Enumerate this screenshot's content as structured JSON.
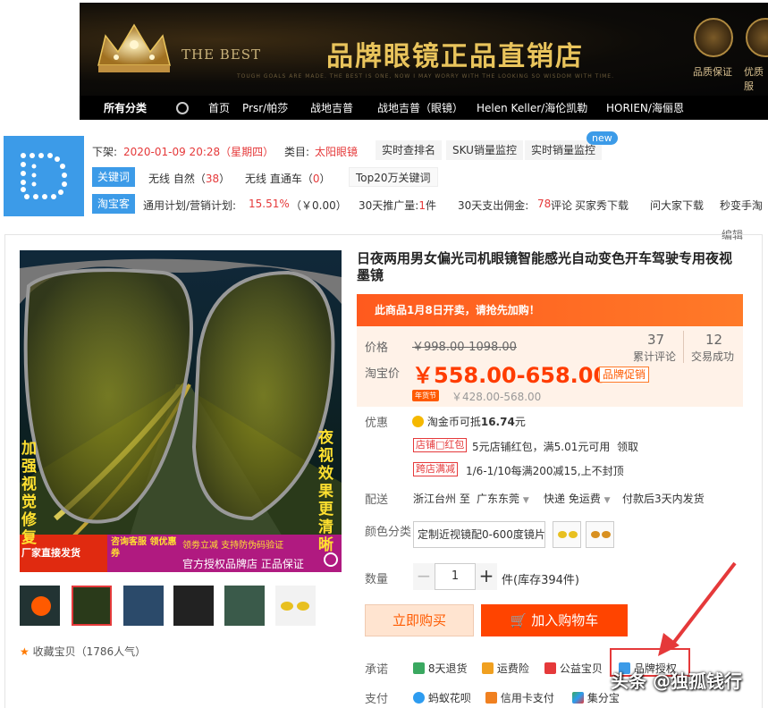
{
  "banner": {
    "best": "THE BEST",
    "shop_name": "品牌眼镜正品直销店",
    "slogan": "TOUGH GOALS ARE MADE. THE BEST IS ONE, NOW I MAY WORRY WITH THE LOOKING SO WISDOM WITH TIME.",
    "badge1": "品质保证",
    "badge2": "优质服"
  },
  "nav": {
    "all": "所有分类",
    "items": [
      "首页",
      "Prsr/帕莎",
      "战地吉普",
      "战地吉普（眼镜）",
      "Helen Keller/海伦凯勒",
      "HORIEN/海俪恩"
    ]
  },
  "plugin": {
    "offshelf_label": "下架:",
    "offshelf_time": "2020-01-09 20:28（星期四）",
    "category_label": "类目:",
    "category": "太阳眼镜",
    "chips": [
      "实时查排名",
      "SKU销量监控",
      "实时销量监控"
    ],
    "new_badge": "new",
    "keyword_tag": "关键词",
    "kw1_label": "无线 自然（",
    "kw1_val": "38",
    "kw1_close": "）",
    "kw2_label": "无线 直通车（",
    "kw2_val": "0",
    "kw2_close": "）",
    "top20": "Top20万关键词",
    "tbk_tag": "淘宝客",
    "plan_label": "通用计划/营销计划:",
    "plan_pct": "15.51%",
    "plan_amt": "（￥0.00）",
    "promo_label": "30天推广量:",
    "promo_val": "1",
    "promo_unit": "件",
    "spend_label": "30天支出佣金:",
    "spend_val": "78",
    "more_chips": [
      "评论",
      "买家秀下载",
      "问大家下载",
      "秒变手淘"
    ]
  },
  "edit": "编辑",
  "product": {
    "title": "日夜两用男女偏光司机眼镜智能感光自动变色开车驾驶专用夜视墨镜",
    "notice": "此商品1月8日开卖，请抢先加购！",
    "price_label": "价格",
    "old_price": "￥998.00-1098.00",
    "reviews_num": "37",
    "reviews_label": "累计评论",
    "sold_num": "12",
    "sold_label": "交易成功",
    "tb_price_label": "淘宝价",
    "price": "￥558.00-658.00",
    "brand_promo": "品牌促销",
    "nianhuo": "年货节",
    "nian_price": "￥428.00-568.00",
    "discount_label": "优惠",
    "coin_text": "淘金币可抵",
    "coin_val": "16.74",
    "coin_unit": "元",
    "shop_tag": "店铺□红包",
    "shop_text": "5元店铺红包，满5.01元可用",
    "claim": "领取",
    "cross_tag": "跨店满减",
    "cross_text": "1/6-1/10每满200减15,上不封顶",
    "ship_label": "配送",
    "ship_from": "浙江台州 至",
    "ship_to": "广东东莞",
    "ship_fee": "快递 免运费",
    "ship_pay": "付款后3天内发货",
    "color_label": "颜色分类",
    "sku": "定制近视镜配0-600度镜片",
    "qty_label": "数量",
    "qty_minus": "−",
    "qty": "1",
    "qty_plus": "+",
    "stock": "件(库存394件)",
    "buy_now": "立即购买",
    "add_cart": "加入购物车",
    "promise_label": "承诺",
    "promises": [
      "8天退货",
      "运费险",
      "公益宝贝",
      "品牌授权"
    ],
    "pay_label": "支付",
    "pays": [
      "蚂蚁花呗",
      "信用卡支付",
      "集分宝"
    ],
    "fav": "收藏宝贝（1786人气）",
    "img_text_left": "加强视觉修复",
    "img_text_right": "夜视效果更清晰",
    "img_banner1": "厂家直接发货",
    "img_banner2": "咨询客服 领优惠券",
    "img_banner3": "领劵立减 支持防伪码验证",
    "img_banner4": "官方授权品牌店 正品保证"
  },
  "watermark": "头条 @独孤钱行"
}
